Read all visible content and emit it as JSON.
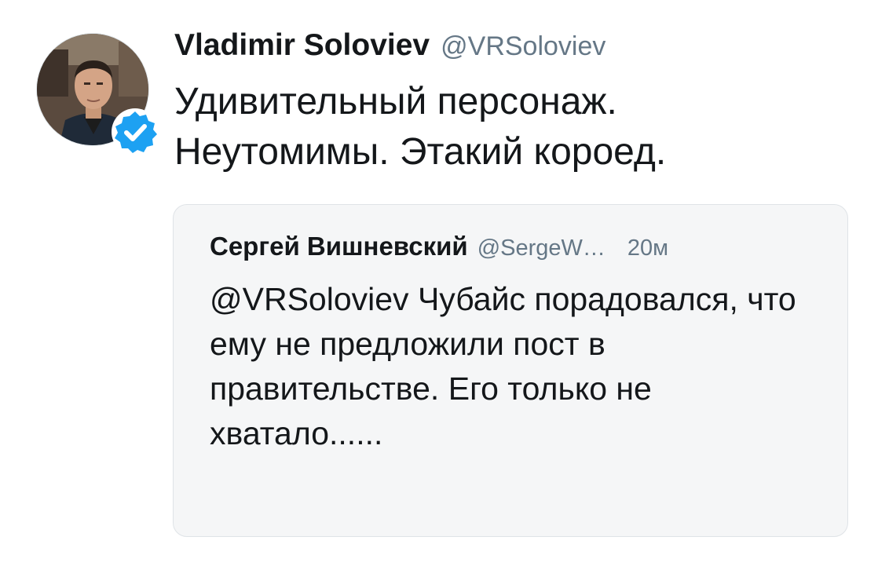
{
  "tweet": {
    "display_name": "Vladimir Soloviev",
    "handle": "@VRSoloviev",
    "verified": true,
    "text_line1": "Удивительный персонаж.",
    "text_line2": "Неутомимы. Этакий короед."
  },
  "quoted_tweet": {
    "display_name": "Сергей Вишневский",
    "handle": "@SergeW…",
    "time": "20м",
    "text": "@VRSoloviev Чубайс порадовался, что ему не предложили пост в правительстве. Его только не хватало......"
  },
  "colors": {
    "text_primary": "#14171a",
    "text_secondary": "#657786",
    "verified_blue": "#1da1f2",
    "quote_background": "#f5f6f7",
    "quote_border": "#dfe3e7"
  },
  "icons": {
    "avatar": "profile-photo",
    "badge": "verified-badge-icon"
  }
}
